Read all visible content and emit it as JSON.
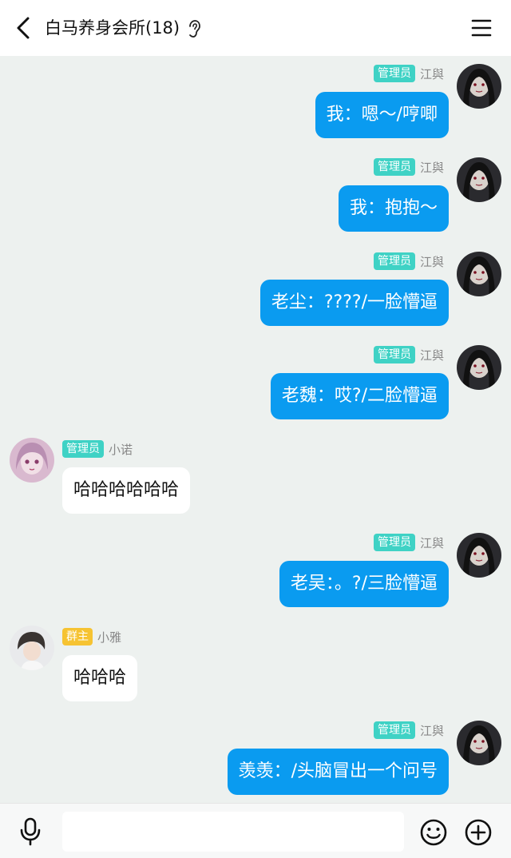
{
  "header": {
    "title": "白马养身会所(18)",
    "icons": {
      "back": "chevron-left-icon",
      "ear": "ear-icon",
      "menu": "hamburger-menu-icon"
    }
  },
  "messages": [
    {
      "side": "right",
      "badge": "管理员",
      "badge_type": "admin",
      "nick": "江與",
      "text": "我：嗯～/哼唧",
      "avatar": "dark-hair-avatar"
    },
    {
      "side": "right",
      "badge": "管理员",
      "badge_type": "admin",
      "nick": "江與",
      "text": "我：抱抱～",
      "avatar": "dark-hair-avatar"
    },
    {
      "side": "right",
      "badge": "管理员",
      "badge_type": "admin",
      "nick": "江與",
      "text": "老尘：????/一脸懵逼",
      "avatar": "dark-hair-avatar"
    },
    {
      "side": "right",
      "badge": "管理员",
      "badge_type": "admin",
      "nick": "江與",
      "text": "老魏：哎?/二脸懵逼",
      "avatar": "dark-hair-avatar"
    },
    {
      "side": "left",
      "badge": "管理员",
      "badge_type": "admin",
      "nick": "小诺",
      "text": "哈哈哈哈哈哈",
      "avatar": "pink-anime-avatar"
    },
    {
      "side": "right",
      "badge": "管理员",
      "badge_type": "admin",
      "nick": "江與",
      "text": "老吴：。?/三脸懵逼",
      "avatar": "dark-hair-avatar"
    },
    {
      "side": "left",
      "badge": "群主",
      "badge_type": "owner",
      "nick": "小雅",
      "text": "哈哈哈",
      "avatar": "light-photo-avatar"
    },
    {
      "side": "right",
      "badge": "管理员",
      "badge_type": "admin",
      "nick": "江與",
      "text": "羡羡：/头脑冒出一个问号",
      "avatar": "dark-hair-avatar"
    }
  ],
  "footer": {
    "input_placeholder": "",
    "icons": {
      "mic": "microphone-icon",
      "emoji": "smiley-icon",
      "plus": "plus-circle-icon"
    }
  },
  "colors": {
    "accent_bubble": "#0a9bf0",
    "admin_badge": "#3fd2c5",
    "owner_badge": "#f6c332",
    "chat_background": "#edf1ef"
  }
}
